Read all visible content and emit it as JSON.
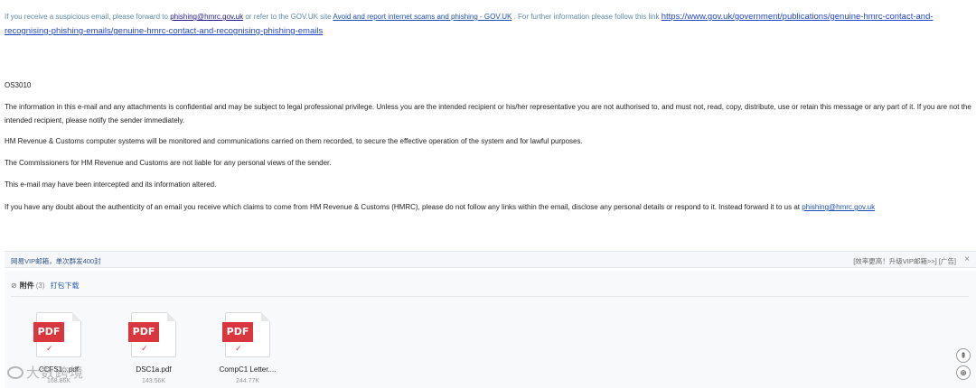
{
  "notice": {
    "prefix": "If you receive a suspicious email, please forward to ",
    "email": "phishing@hmrc.gov.uk",
    "middle": " or refer to the GOV.UK site ",
    "site_link": "Avoid and report internet scams and phishing - GOV.UK",
    "suffix": " . For further information please follow this link ",
    "url_link": "https://www.gov.uk/government/publications/genuine-hmrc-contact-and-recognising-phishing-emails/genuine-hmrc-contact-and-recognising-phishing-emails"
  },
  "reference": "OS3010",
  "disclaimer": {
    "p1": "The information in this e-mail and any attachments is confidential and may be subject to legal professional privilege. Unless you are the intended recipient or his/her representative you are not authorised to, and must not, read, copy, distribute, use or retain this message or any part of it. If you are not the intended recipient, please notify the sender immediately.",
    "p2": "HM Revenue & Customs computer systems will be monitored and communications carried on them recorded, to secure the effective operation of the system and for lawful purposes.",
    "p3": "The Commissioners for HM Revenue and Customs are not liable for any personal views of the sender.",
    "p4": "This e-mail may have been intercepted and its information altered.",
    "p5_text": "If you have any doubt about the authenticity of an email you receive which claims to come from HM Revenue & Customs (HMRC), please do not follow any links within the email, disclose any personal details or respond to it. Instead forward it to us at ",
    "p5_email": "phishing@hmrc.gov.uk"
  },
  "ad": {
    "left": "网易VIP邮箱，单次群发400封",
    "right": "[效率更高！升级VIP邮箱>>] [广告]",
    "close": "×"
  },
  "attachments": {
    "title": "附件",
    "count": "(3)",
    "download_all": "打包下载",
    "files": [
      {
        "name": "CCFS1...pdf",
        "size": "168.86K",
        "type": "PDF"
      },
      {
        "name": "DSC1a.pdf",
        "size": "143.56K",
        "type": "PDF"
      },
      {
        "name": "CompC1 Letter....",
        "size": "244.77K",
        "type": "PDF"
      }
    ]
  },
  "watermark": "大数跨境",
  "icons": {
    "clip": "paperclip-icon",
    "close": "close-icon",
    "back_to_top": "back-to-top-icon",
    "zoom": "zoom-icon"
  },
  "colors": {
    "pdf_red": "#d9363e",
    "link_blue": "#1f4fb3"
  }
}
